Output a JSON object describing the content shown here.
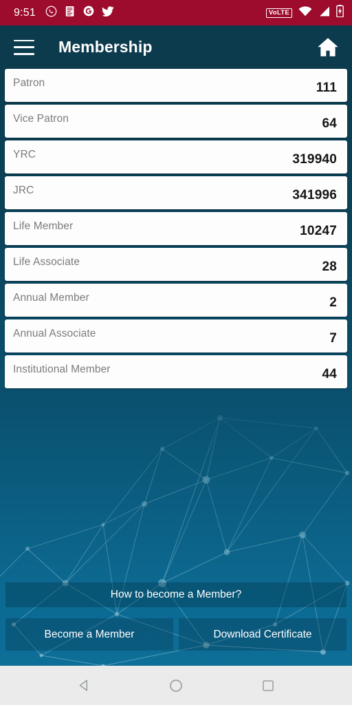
{
  "status_bar": {
    "time": "9:51",
    "left_icons": [
      "whatsapp-icon",
      "news-document-icon",
      "google-icon",
      "twitter-icon"
    ],
    "volte_label": "VoLTE",
    "right_icons": [
      "wifi-icon",
      "cellular-signal-icon",
      "battery-charging-icon"
    ],
    "background_color": "#9d0b2d"
  },
  "app_bar": {
    "title": "Membership",
    "menu_icon": "hamburger-menu-icon",
    "home_icon": "home-icon",
    "background_color": "#0d3b4e"
  },
  "membership": {
    "rows": [
      {
        "label": "Patron",
        "value": "111"
      },
      {
        "label": "Vice Patron",
        "value": "64"
      },
      {
        "label": "YRC",
        "value": "319940"
      },
      {
        "label": "JRC",
        "value": "341996"
      },
      {
        "label": "Life Member",
        "value": "10247"
      },
      {
        "label": "Life Associate",
        "value": "28"
      },
      {
        "label": "Annual Member",
        "value": "2"
      },
      {
        "label": "Annual Associate",
        "value": "7"
      },
      {
        "label": "Institutional Member",
        "value": "44"
      }
    ]
  },
  "actions": {
    "how_to_become": "How to become a Member?",
    "become_member": "Become a Member",
    "download_certificate": "Download Certificate"
  },
  "nav_bar": {
    "back_icon": "back-triangle-icon",
    "home_icon": "home-circle-icon",
    "recents_icon": "recents-square-icon",
    "background_color": "#ebebeb"
  },
  "theme": {
    "accent_dark": "#0d3b4e",
    "gradient_top": "#0a3d50",
    "gradient_bottom": "#0d6e97",
    "card_background": "#fdfdfd",
    "label_color": "#7b7b7b",
    "value_color": "#151515"
  }
}
